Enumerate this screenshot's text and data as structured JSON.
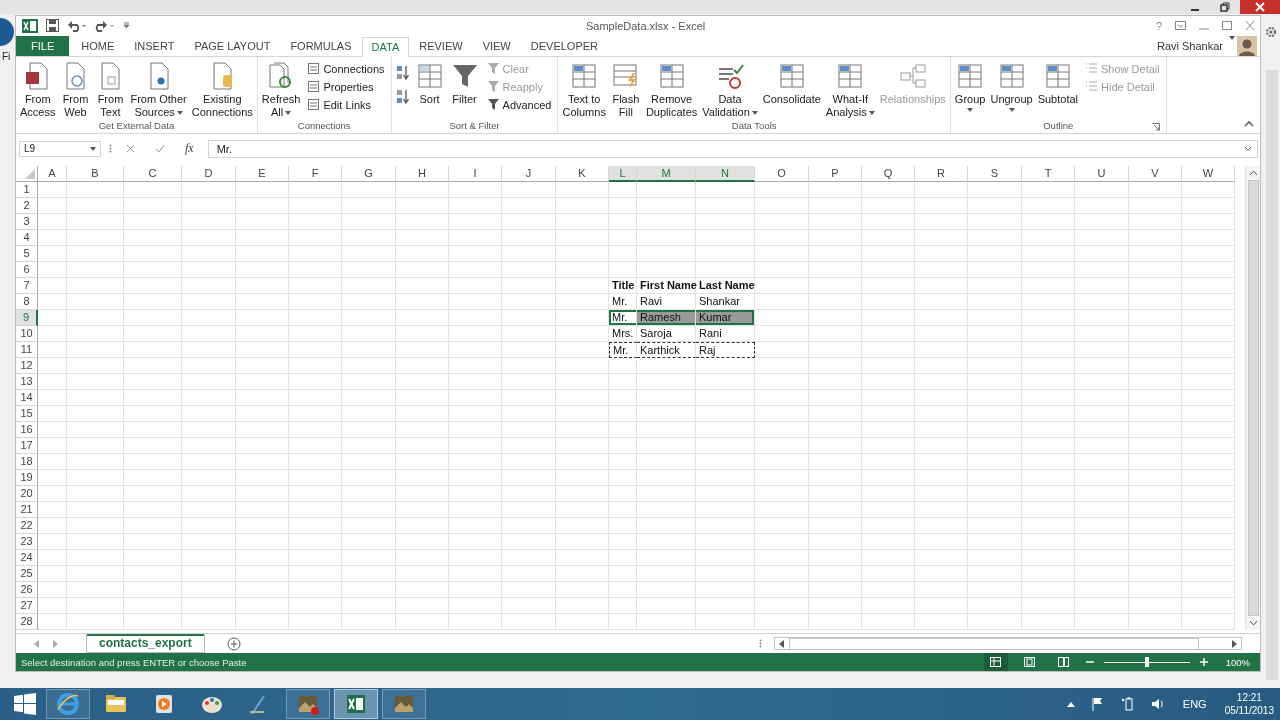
{
  "background_window": {
    "label": "Fi"
  },
  "window": {
    "title": "SampleData.xlsx - Excel",
    "help": "?",
    "user": "Ravi Shankar"
  },
  "tabs": [
    {
      "label": "FILE",
      "kind": "file",
      "selected": false
    },
    {
      "label": "HOME",
      "kind": "tab",
      "selected": false
    },
    {
      "label": "INSERT",
      "kind": "tab",
      "selected": false
    },
    {
      "label": "PAGE LAYOUT",
      "kind": "tab",
      "selected": false
    },
    {
      "label": "FORMULAS",
      "kind": "tab",
      "selected": false
    },
    {
      "label": "DATA",
      "kind": "tab",
      "selected": true
    },
    {
      "label": "REVIEW",
      "kind": "tab",
      "selected": false
    },
    {
      "label": "VIEW",
      "kind": "tab",
      "selected": false
    },
    {
      "label": "DEVELOPER",
      "kind": "tab",
      "selected": false
    }
  ],
  "ribbon": {
    "groups": [
      {
        "label": "Get External Data",
        "launcher": false,
        "items": [
          {
            "kind": "large",
            "label": "From\nAccess",
            "dropdown": false,
            "disabled": false
          },
          {
            "kind": "large",
            "label": "From\nWeb",
            "dropdown": false,
            "disabled": false
          },
          {
            "kind": "large",
            "label": "From\nText",
            "dropdown": false,
            "disabled": false
          },
          {
            "kind": "large",
            "label": "From Other\nSources",
            "dropdown": true,
            "disabled": false
          },
          {
            "kind": "large",
            "label": "Existing\nConnections",
            "dropdown": false,
            "disabled": false
          }
        ]
      },
      {
        "label": "Connections",
        "launcher": false,
        "items": [
          {
            "kind": "large",
            "label": "Refresh\nAll",
            "dropdown": true,
            "disabled": false
          },
          {
            "kind": "stack",
            "buttons": [
              {
                "label": "Connections",
                "disabled": false
              },
              {
                "label": "Properties",
                "disabled": false
              },
              {
                "label": "Edit Links",
                "disabled": false
              }
            ]
          }
        ]
      },
      {
        "label": "Sort & Filter",
        "launcher": false,
        "items": [
          {
            "kind": "sort-icons"
          },
          {
            "kind": "large",
            "label": "Sort",
            "dropdown": false,
            "disabled": false
          },
          {
            "kind": "large",
            "label": "Filter",
            "dropdown": false,
            "disabled": false
          },
          {
            "kind": "stack",
            "buttons": [
              {
                "label": "Clear",
                "disabled": true
              },
              {
                "label": "Reapply",
                "disabled": true
              },
              {
                "label": "Advanced",
                "disabled": false
              }
            ]
          }
        ]
      },
      {
        "label": "Data Tools",
        "launcher": false,
        "items": [
          {
            "kind": "large",
            "label": "Text to\nColumns",
            "dropdown": false,
            "disabled": false
          },
          {
            "kind": "large",
            "label": "Flash\nFill",
            "dropdown": false,
            "disabled": false
          },
          {
            "kind": "large",
            "label": "Remove\nDuplicates",
            "dropdown": false,
            "disabled": false
          },
          {
            "kind": "large",
            "label": "Data\nValidation",
            "dropdown": true,
            "disabled": false
          },
          {
            "kind": "large",
            "label": "Consolidate",
            "dropdown": false,
            "disabled": false
          },
          {
            "kind": "large",
            "label": "What-If\nAnalysis",
            "dropdown": true,
            "disabled": false
          },
          {
            "kind": "large",
            "label": "Relationships",
            "dropdown": false,
            "disabled": true
          }
        ]
      },
      {
        "label": "Outline",
        "launcher": true,
        "items": [
          {
            "kind": "large",
            "label": "Group",
            "dropdown": true,
            "disabled": false
          },
          {
            "kind": "large",
            "label": "Ungroup",
            "dropdown": true,
            "disabled": false
          },
          {
            "kind": "large",
            "label": "Subtotal",
            "dropdown": false,
            "disabled": false
          },
          {
            "kind": "stack",
            "buttons": [
              {
                "label": "Show Detail",
                "disabled": true
              },
              {
                "label": "Hide Detail",
                "disabled": true
              }
            ]
          }
        ]
      }
    ]
  },
  "formula_bar": {
    "name_box": "L9",
    "function_button": "fx",
    "formula": "Mr."
  },
  "columns": [
    {
      "label": "A",
      "selected": false
    },
    {
      "label": "B",
      "selected": false
    },
    {
      "label": "C",
      "selected": false
    },
    {
      "label": "D",
      "selected": false
    },
    {
      "label": "E",
      "selected": false
    },
    {
      "label": "F",
      "selected": false
    },
    {
      "label": "G",
      "selected": false
    },
    {
      "label": "H",
      "selected": false
    },
    {
      "label": "I",
      "selected": false
    },
    {
      "label": "J",
      "selected": false
    },
    {
      "label": "K",
      "selected": false
    },
    {
      "label": "L",
      "selected": true
    },
    {
      "label": "M",
      "selected": true
    },
    {
      "label": "N",
      "selected": true
    },
    {
      "label": "O",
      "selected": false
    },
    {
      "label": "P",
      "selected": false
    },
    {
      "label": "Q",
      "selected": false
    },
    {
      "label": "R",
      "selected": false
    },
    {
      "label": "S",
      "selected": false
    },
    {
      "label": "T",
      "selected": false
    },
    {
      "label": "U",
      "selected": false
    },
    {
      "label": "V",
      "selected": false
    },
    {
      "label": "W",
      "selected": false
    }
  ],
  "rows": [
    {
      "number": "1",
      "selected": false
    },
    {
      "number": "2",
      "selected": false
    },
    {
      "number": "3",
      "selected": false
    },
    {
      "number": "4",
      "selected": false
    },
    {
      "number": "5",
      "selected": false
    },
    {
      "number": "6",
      "selected": false
    },
    {
      "number": "7",
      "selected": false,
      "cells": [
        null,
        null,
        null,
        null,
        null,
        null,
        null,
        null,
        null,
        null,
        null,
        {
          "text": "Title",
          "bold": true,
          "selected": false,
          "active": false,
          "copied": false
        },
        {
          "text": "First Name",
          "bold": true,
          "selected": false,
          "active": false,
          "copied": false
        },
        {
          "text": "Last Name",
          "bold": true,
          "selected": false,
          "active": false,
          "copied": false
        }
      ]
    },
    {
      "number": "8",
      "selected": false,
      "cells": [
        null,
        null,
        null,
        null,
        null,
        null,
        null,
        null,
        null,
        null,
        null,
        {
          "text": "Mr.",
          "bold": false,
          "selected": false,
          "active": false,
          "copied": false
        },
        {
          "text": "Ravi",
          "bold": false,
          "selected": false,
          "active": false,
          "copied": false
        },
        {
          "text": "Shankar",
          "bold": false,
          "selected": false,
          "active": false,
          "copied": false
        }
      ]
    },
    {
      "number": "9",
      "selected": true,
      "cells": [
        null,
        null,
        null,
        null,
        null,
        null,
        null,
        null,
        null,
        null,
        null,
        {
          "text": "Mr.",
          "bold": false,
          "selected": false,
          "active": true,
          "copied": false
        },
        {
          "text": "Ramesh",
          "bold": false,
          "selected": true,
          "active": false,
          "copied": false
        },
        {
          "text": "Kumar",
          "bold": false,
          "selected": true,
          "active": false,
          "copied": false
        }
      ]
    },
    {
      "number": "10",
      "selected": false,
      "cells": [
        null,
        null,
        null,
        null,
        null,
        null,
        null,
        null,
        null,
        null,
        null,
        {
          "text": "Mrs.",
          "bold": false,
          "selected": false,
          "active": false,
          "copied": false
        },
        {
          "text": "Saroja",
          "bold": false,
          "selected": false,
          "active": false,
          "copied": false
        },
        {
          "text": "Rani",
          "bold": false,
          "selected": false,
          "active": false,
          "copied": false
        }
      ]
    },
    {
      "number": "11",
      "selected": false,
      "cells": [
        null,
        null,
        null,
        null,
        null,
        null,
        null,
        null,
        null,
        null,
        null,
        {
          "text": "Mr.",
          "bold": false,
          "selected": false,
          "active": false,
          "copied": true
        },
        {
          "text": "Karthick",
          "bold": false,
          "selected": false,
          "active": false,
          "copied": true
        },
        {
          "text": "Raj",
          "bold": false,
          "selected": false,
          "active": false,
          "copied": true
        }
      ]
    },
    {
      "number": "12",
      "selected": false
    },
    {
      "number": "13",
      "selected": false
    },
    {
      "number": "14",
      "selected": false
    },
    {
      "number": "15",
      "selected": false
    },
    {
      "number": "16",
      "selected": false
    },
    {
      "number": "17",
      "selected": false
    },
    {
      "number": "18",
      "selected": false
    },
    {
      "number": "19",
      "selected": false
    },
    {
      "number": "20",
      "selected": false
    },
    {
      "number": "21",
      "selected": false
    },
    {
      "number": "22",
      "selected": false
    },
    {
      "number": "23",
      "selected": false
    },
    {
      "number": "24",
      "selected": false
    },
    {
      "number": "25",
      "selected": false
    },
    {
      "number": "26",
      "selected": false
    },
    {
      "number": "27",
      "selected": false
    },
    {
      "number": "28",
      "selected": false
    }
  ],
  "sheet_tabs": [
    {
      "label": "contacts_export",
      "selected": true
    }
  ],
  "status_bar": {
    "message": "Select destination and press ENTER or choose Paste",
    "views": [
      {
        "selected": true
      },
      {
        "selected": false
      },
      {
        "selected": false
      }
    ],
    "zoom": {
      "level": 0.5,
      "label": "100%"
    }
  },
  "taskbar": {
    "apps": [
      {
        "running": true,
        "selected": false
      },
      {
        "running": false,
        "selected": false
      },
      {
        "running": false,
        "selected": false
      },
      {
        "running": false,
        "selected": false
      },
      {
        "running": false,
        "selected": false
      },
      {
        "running": true,
        "selected": false
      },
      {
        "running": true,
        "selected": true
      },
      {
        "running": true,
        "selected": false
      }
    ],
    "language": "ENG",
    "time": "12:21",
    "date": "05/11/2013"
  }
}
